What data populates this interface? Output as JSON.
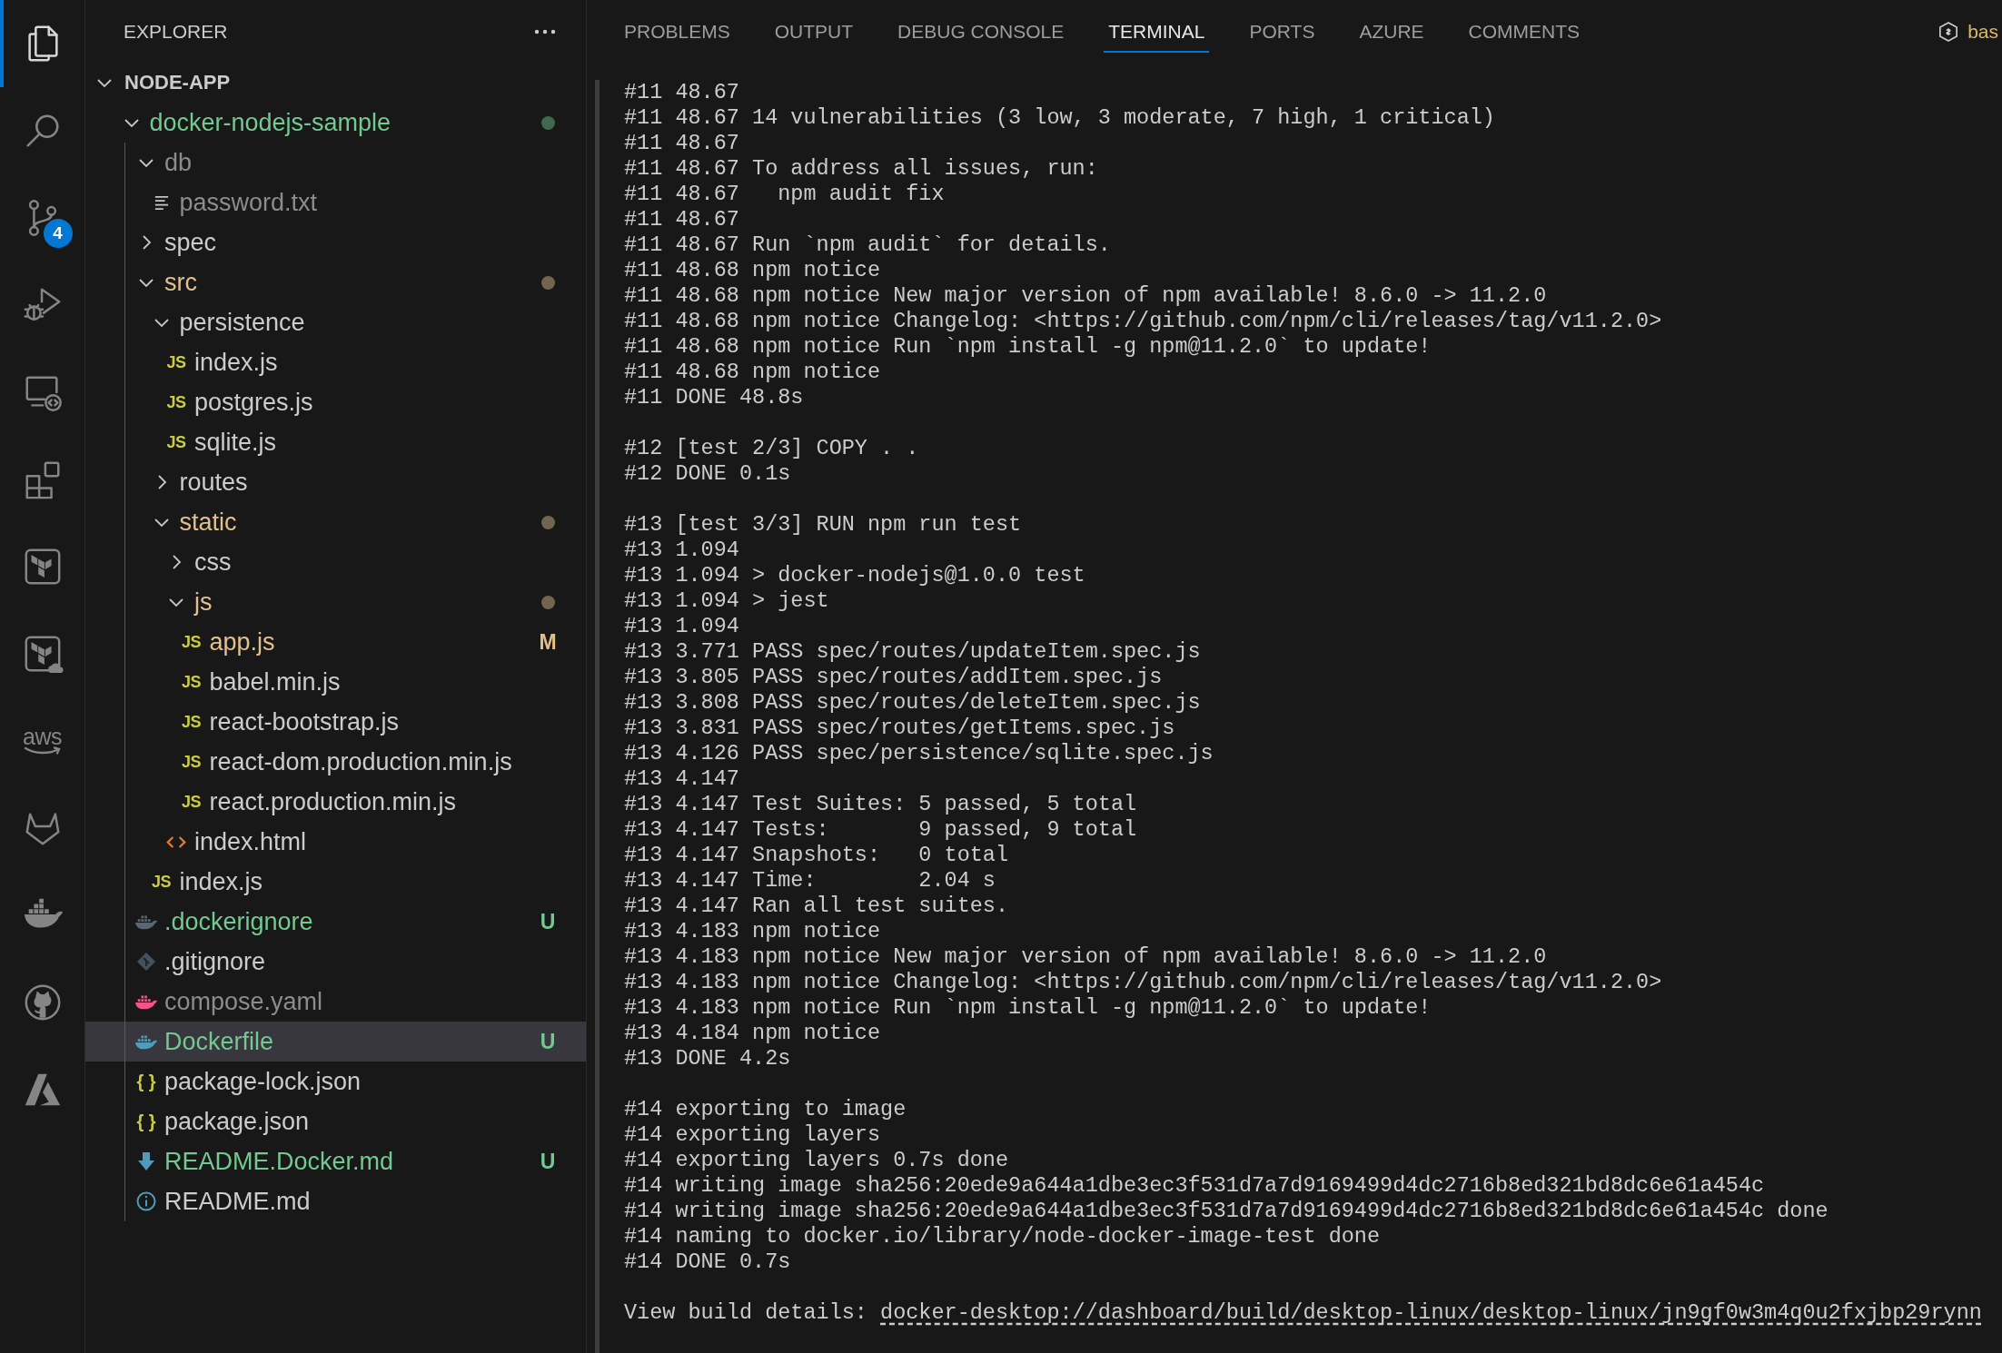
{
  "activity_bar": [
    {
      "kind": "explorer",
      "selected": true
    },
    {
      "kind": "search",
      "selected": false
    },
    {
      "kind": "source-control",
      "selected": false,
      "badge": "4"
    },
    {
      "kind": "run-debug",
      "selected": false
    },
    {
      "kind": "remote-explorer",
      "selected": false
    },
    {
      "kind": "extensions",
      "selected": false
    },
    {
      "kind": "terraform",
      "selected": false
    },
    {
      "kind": "terraform-cloud",
      "selected": false
    },
    {
      "kind": "aws",
      "selected": false,
      "label": "aws"
    },
    {
      "kind": "gitlab",
      "selected": false
    },
    {
      "kind": "docker",
      "selected": false
    },
    {
      "kind": "github",
      "selected": false
    },
    {
      "kind": "azure",
      "selected": false
    }
  ],
  "explorer": {
    "title": "EXPLORER",
    "root": {
      "name": "NODE-APP",
      "expanded": true,
      "children": [
        {
          "name": "docker-nodejs-sample",
          "kind": "folder",
          "expanded": true,
          "selected": false,
          "color": "#73c991",
          "dot": true,
          "children": [
            {
              "name": "db",
              "kind": "folder",
              "expanded": true,
              "selected": false,
              "color": "#8c8c8c",
              "dot": false,
              "children": [
                {
                  "name": "password.txt",
                  "kind": "text-file",
                  "selected": false,
                  "color": "#8c8c8c",
                  "dot": false
                }
              ]
            },
            {
              "name": "spec",
              "kind": "folder",
              "expanded": false,
              "selected": false,
              "color": "#cccccc",
              "dot": false
            },
            {
              "name": "src",
              "kind": "folder",
              "expanded": true,
              "selected": false,
              "color": "#e2c08d",
              "dot": true,
              "children": [
                {
                  "name": "persistence",
                  "kind": "folder",
                  "expanded": true,
                  "selected": false,
                  "color": "#cccccc",
                  "dot": false,
                  "children": [
                    {
                      "name": "index.js",
                      "kind": "js-file",
                      "icon_text": "JS",
                      "selected": false,
                      "color": "#cccccc",
                      "dot": false
                    },
                    {
                      "name": "postgres.js",
                      "kind": "js-file",
                      "icon_text": "JS",
                      "selected": false,
                      "color": "#cccccc",
                      "dot": false
                    },
                    {
                      "name": "sqlite.js",
                      "kind": "js-file",
                      "icon_text": "JS",
                      "selected": false,
                      "color": "#cccccc",
                      "dot": false
                    }
                  ]
                },
                {
                  "name": "routes",
                  "kind": "folder",
                  "expanded": false,
                  "selected": false,
                  "color": "#cccccc",
                  "dot": false
                },
                {
                  "name": "static",
                  "kind": "folder",
                  "expanded": true,
                  "selected": false,
                  "color": "#e2c08d",
                  "dot": true,
                  "children": [
                    {
                      "name": "css",
                      "kind": "folder",
                      "expanded": false,
                      "selected": false,
                      "color": "#cccccc",
                      "dot": false
                    },
                    {
                      "name": "js",
                      "kind": "folder",
                      "expanded": true,
                      "selected": false,
                      "color": "#e2c08d",
                      "dot": true,
                      "children": [
                        {
                          "name": "app.js",
                          "kind": "js-file",
                          "icon_text": "JS",
                          "selected": false,
                          "color": "#e2c08d",
                          "dot": false,
                          "badge": "M"
                        },
                        {
                          "name": "babel.min.js",
                          "kind": "js-file",
                          "icon_text": "JS",
                          "selected": false,
                          "color": "#cccccc",
                          "dot": false
                        },
                        {
                          "name": "react-bootstrap.js",
                          "kind": "js-file",
                          "icon_text": "JS",
                          "selected": false,
                          "color": "#cccccc",
                          "dot": false
                        },
                        {
                          "name": "react-dom.production.min.js",
                          "kind": "js-file",
                          "icon_text": "JS",
                          "selected": false,
                          "color": "#cccccc",
                          "dot": false
                        },
                        {
                          "name": "react.production.min.js",
                          "kind": "js-file",
                          "icon_text": "JS",
                          "selected": false,
                          "color": "#cccccc",
                          "dot": false
                        }
                      ]
                    },
                    {
                      "name": "index.html",
                      "kind": "html-file",
                      "selected": false,
                      "color": "#cccccc",
                      "dot": false
                    }
                  ]
                },
                {
                  "name": "index.js",
                  "kind": "js-file",
                  "icon_text": "JS",
                  "selected": false,
                  "color": "#cccccc",
                  "dot": false
                }
              ]
            },
            {
              "name": ".dockerignore",
              "kind": "dockerignore-file",
              "selected": false,
              "color": "#73c991",
              "dot": false,
              "badge": "U"
            },
            {
              "name": ".gitignore",
              "kind": "gitignore-file",
              "selected": false,
              "color": "#cccccc",
              "dot": false
            },
            {
              "name": "compose.yaml",
              "kind": "compose-file",
              "selected": false,
              "color": "#8c8c8c",
              "dot": false
            },
            {
              "name": "Dockerfile",
              "kind": "dockerfile",
              "selected": true,
              "color": "#73c991",
              "dot": false,
              "badge": "U"
            },
            {
              "name": "package-lock.json",
              "kind": "json-file",
              "icon_text": "{ }",
              "selected": false,
              "color": "#cccccc",
              "dot": false
            },
            {
              "name": "package.json",
              "kind": "json-file",
              "icon_text": "{ }",
              "selected": false,
              "color": "#cccccc",
              "dot": false
            },
            {
              "name": "README.Docker.md",
              "kind": "markdown-file",
              "selected": false,
              "color": "#73c991",
              "dot": false,
              "badge": "U"
            },
            {
              "name": "README.md",
              "kind": "readme-file",
              "selected": false,
              "color": "#cccccc",
              "dot": false
            }
          ]
        }
      ]
    }
  },
  "panel": {
    "tabs": [
      {
        "label": "PROBLEMS",
        "selected": false
      },
      {
        "label": "OUTPUT",
        "selected": false
      },
      {
        "label": "DEBUG CONSOLE",
        "selected": false
      },
      {
        "label": "TERMINAL",
        "selected": true
      },
      {
        "label": "PORTS",
        "selected": false
      },
      {
        "label": "AZURE",
        "selected": false
      },
      {
        "label": "COMMENTS",
        "selected": false
      }
    ],
    "shell": {
      "name": "bas"
    }
  },
  "terminal": {
    "blocks": [
      {
        "lines": [
          "#11 48.67",
          "#11 48.67 14 vulnerabilities (3 low, 3 moderate, 7 high, 1 critical)",
          "#11 48.67",
          "#11 48.67 To address all issues, run:",
          "#11 48.67   npm audit fix",
          "#11 48.67",
          "#11 48.67 Run `npm audit` for details.",
          "#11 48.68 npm notice",
          "#11 48.68 npm notice New major version of npm available! 8.6.0 -> 11.2.0",
          "#11 48.68 npm notice Changelog: <https://github.com/npm/cli/releases/tag/v11.2.0>",
          "#11 48.68 npm notice Run `npm install -g npm@11.2.0` to update!",
          "#11 48.68 npm notice",
          "#11 DONE 48.8s"
        ]
      },
      {
        "lines": [
          "#12 [test 2/3] COPY . .",
          "#12 DONE 0.1s"
        ]
      },
      {
        "lines": [
          "#13 [test 3/3] RUN npm run test",
          "#13 1.094",
          "#13 1.094 > docker-nodejs@1.0.0 test",
          "#13 1.094 > jest",
          "#13 1.094",
          "#13 3.771 PASS spec/routes/updateItem.spec.js",
          "#13 3.805 PASS spec/routes/addItem.spec.js",
          "#13 3.808 PASS spec/routes/deleteItem.spec.js",
          "#13 3.831 PASS spec/routes/getItems.spec.js",
          "#13 4.126 PASS spec/persistence/sqlite.spec.js",
          "#13 4.147",
          "#13 4.147 Test Suites: 5 passed, 5 total",
          "#13 4.147 Tests:       9 passed, 9 total",
          "#13 4.147 Snapshots:   0 total",
          "#13 4.147 Time:        2.04 s",
          "#13 4.147 Ran all test suites.",
          "#13 4.183 npm notice",
          "#13 4.183 npm notice New major version of npm available! 8.6.0 -> 11.2.0",
          "#13 4.183 npm notice Changelog: <https://github.com/npm/cli/releases/tag/v11.2.0>",
          "#13 4.183 npm notice Run `npm install -g npm@11.2.0` to update!",
          "#13 4.184 npm notice",
          "#13 DONE 4.2s"
        ]
      },
      {
        "lines": [
          "#14 exporting to image",
          "#14 exporting layers",
          "#14 exporting layers 0.7s done",
          "#14 writing image sha256:20ede9a644a1dbe3ec3f531d7a7d9169499d4dc2716b8ed321bd8dc6e61a454c",
          "#14 writing image sha256:20ede9a644a1dbe3ec3f531d7a7d9169499d4dc2716b8ed321bd8dc6e61a454c done",
          "#14 naming to docker.io/library/node-docker-image-test done",
          "#14 DONE 0.7s"
        ]
      }
    ],
    "footer": {
      "text": "View build details:",
      "link": "docker-desktop://dashboard/build/desktop-linux/desktop-linux/jn9gf0w3m4q0u2fxjbp29rynn"
    }
  }
}
